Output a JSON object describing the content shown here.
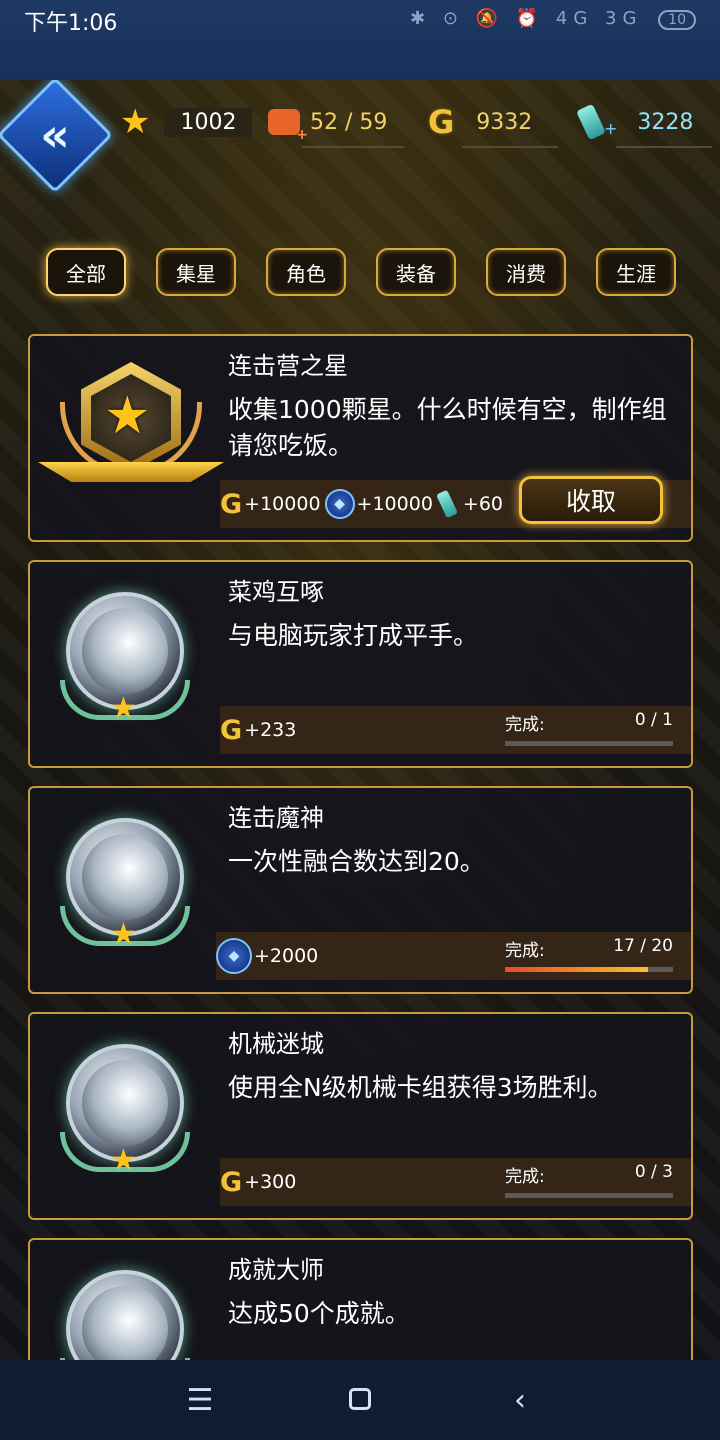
{
  "status_bar": {
    "time": "下午1:06",
    "icons": "✱ ⊙ 🔕 ⏰ 4G 3G",
    "battery": "10"
  },
  "header": {
    "stars": "1002",
    "energy": "52 / 59",
    "gold": "9332",
    "crystals": "3228"
  },
  "tabs": [
    {
      "label": "全部",
      "active": true
    },
    {
      "label": "集星"
    },
    {
      "label": "角色"
    },
    {
      "label": "装备"
    },
    {
      "label": "消费"
    },
    {
      "label": "生涯"
    }
  ],
  "achievements": [
    {
      "title": "连击营之星",
      "desc": "收集1000颗星。什么时候有空，制作组请您吃饭。",
      "rewards": {
        "gold": "+10000",
        "badge": "+10000",
        "crystal": "+60"
      },
      "action": "收取"
    },
    {
      "title": "菜鸡互啄",
      "desc": "与电脑玩家打成平手。",
      "reward": "+233",
      "progress_label": "完成:",
      "progress_value": "0 / 1",
      "progress_fraction": 0
    },
    {
      "title": "连击魔神",
      "desc": "一次性融合数达到20。",
      "reward": "+2000",
      "progress_label": "完成:",
      "progress_value": "17 / 20",
      "progress_fraction": 0.85
    },
    {
      "title": "机械迷城",
      "desc": "使用全N级机械卡组获得3场胜利。",
      "reward": "+300",
      "progress_label": "完成:",
      "progress_value": "0 / 3",
      "progress_fraction": 0
    },
    {
      "title": "成就大师",
      "desc": "达成50个成就。"
    }
  ],
  "icons": {
    "star": "★",
    "gold": "G",
    "back": "«"
  },
  "nav": {
    "menu": "☰",
    "back": "‹"
  },
  "colors": {
    "gold_border": "#c89a3a",
    "progress_start": "#e84a2a",
    "progress_end": "#f6c02a"
  }
}
